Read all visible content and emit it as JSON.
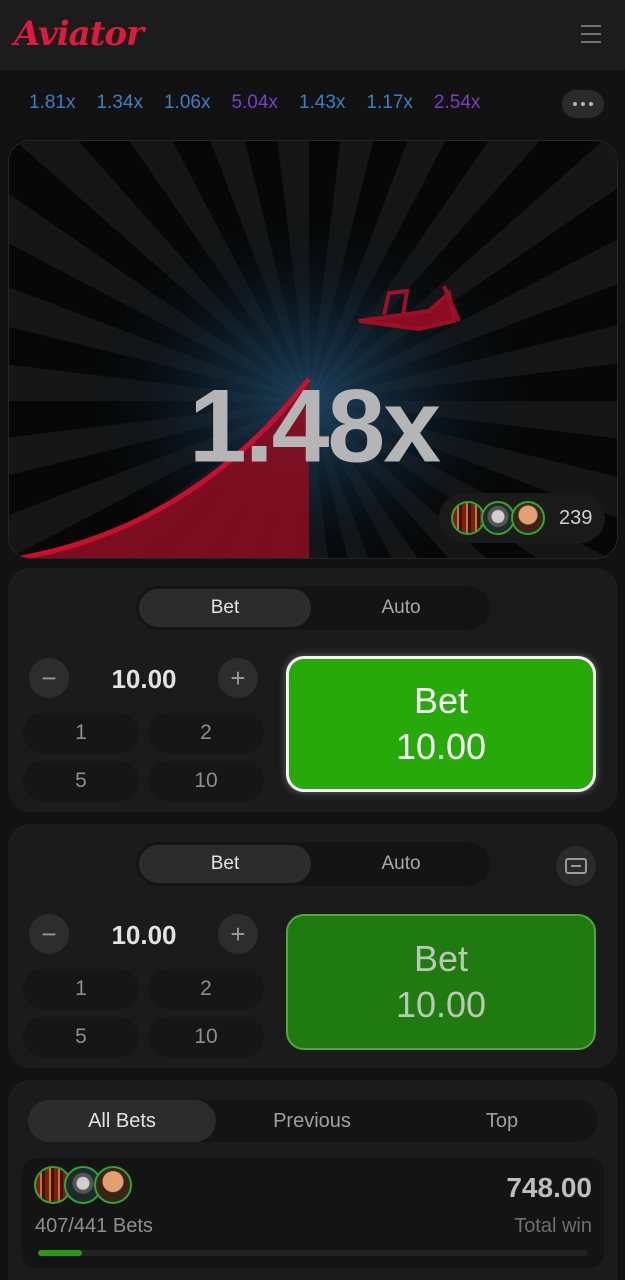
{
  "header": {
    "logo_text": "Aviator",
    "menu_icon": "menu-icon"
  },
  "history": {
    "items": [
      {
        "value": "1.81x",
        "color": "#3d7fc4"
      },
      {
        "value": "1.34x",
        "color": "#3d7fc4"
      },
      {
        "value": "1.06x",
        "color": "#3d7fc4"
      },
      {
        "value": "5.04x",
        "color": "#7a3fc4"
      },
      {
        "value": "1.43x",
        "color": "#3d7fc4"
      },
      {
        "value": "1.17x",
        "color": "#3d7fc4"
      },
      {
        "value": "2.54x",
        "color": "#7a3fc4"
      }
    ],
    "more_icon": "more-dots-icon"
  },
  "game": {
    "multiplier": "1.48x",
    "players_count": "239",
    "plane_color": "#c8102e"
  },
  "panels": [
    {
      "tabs": [
        "Bet",
        "Auto"
      ],
      "amount": "10.00",
      "quick": [
        "1",
        "2",
        "5",
        "10"
      ],
      "button": {
        "line1": "Bet",
        "line2": "10.00"
      }
    },
    {
      "tabs": [
        "Bet",
        "Auto"
      ],
      "amount": "10.00",
      "quick": [
        "1",
        "2",
        "5",
        "10"
      ],
      "button": {
        "line1": "Bet",
        "line2": "10.00"
      }
    }
  ],
  "bets": {
    "tabs": [
      "All Bets",
      "Previous",
      "Top"
    ],
    "count": "407/441",
    "count_suffix": "Bets",
    "total": "748.00",
    "total_label": "Total win",
    "progress": 0.08
  },
  "colors": {
    "accent_red": "#e0193d",
    "bet_green": "#28a90a"
  }
}
